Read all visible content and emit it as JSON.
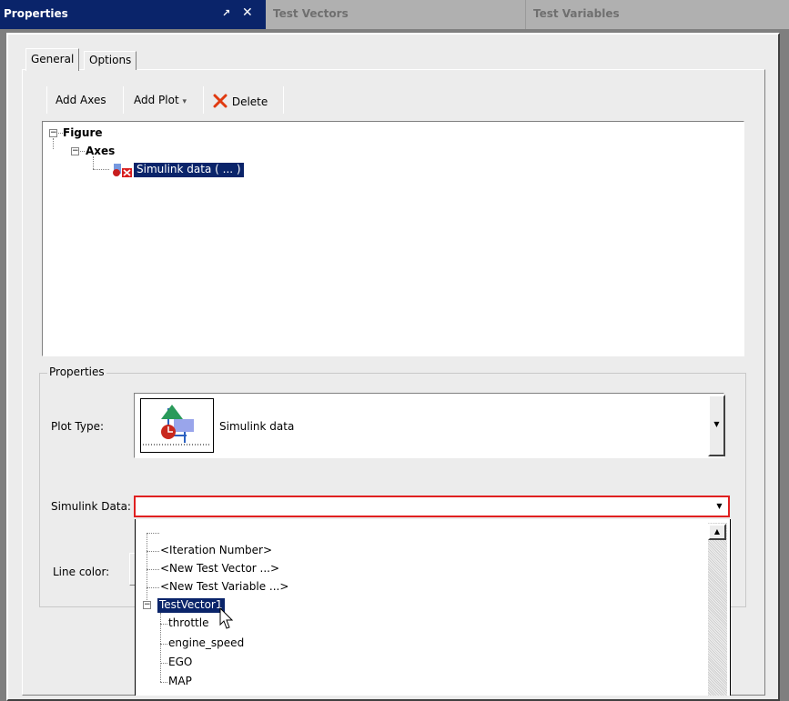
{
  "titlebar": {
    "active_tab": "Properties",
    "pin_glyph": "ᵆ",
    "close_glyph": "✕",
    "tabs": [
      "Test Vectors",
      "Test Variables"
    ]
  },
  "panel_tabs": {
    "general": "General",
    "options": "Options"
  },
  "toolbar": {
    "add_axes": "Add Axes",
    "add_plot": "Add Plot",
    "add_plot_arrow": "▾",
    "delete": "Delete",
    "delete_icon": "close-x-icon"
  },
  "tree": {
    "figure": "Figure",
    "axes": "Axes",
    "plot_item": "Simulink data ( ... )",
    "collapse_glyph": "−"
  },
  "properties": {
    "group_title": "Properties",
    "plot_type_label": "Plot Type:",
    "plot_type_value": "Simulink data",
    "simulink_data_label": "Simulink Data:",
    "simulink_data_value": "",
    "line_color_label": "Line color:",
    "dropdown_arrow": "▼"
  },
  "dropdown_list": {
    "items": [
      "<Iteration Number>",
      "<New Test Vector ...>",
      "<New Test Variable ...>"
    ],
    "group": "TestVector1",
    "children": [
      "throttle",
      "engine_speed",
      "EGO",
      "MAP"
    ],
    "scroll_up": "▲"
  },
  "colors": {
    "selection": "#0a246a",
    "error_border": "#e02020",
    "delete_icon": "#e03a10"
  }
}
